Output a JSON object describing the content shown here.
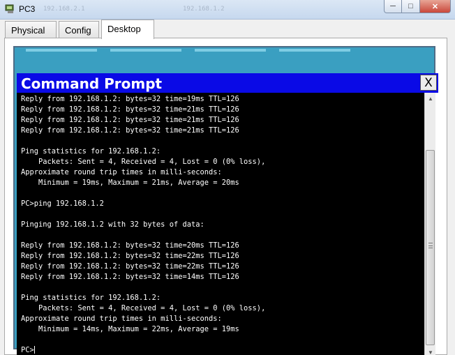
{
  "window": {
    "title": "PC3",
    "ghost_texts": [
      "192.168.2.1",
      "192.168.1.2"
    ],
    "icons": {
      "app": "pc-icon",
      "minimize": "minimize-icon",
      "maximize": "maximize-icon",
      "close": "close-icon"
    },
    "minimize_glyph": "─",
    "maximize_glyph": "□",
    "close_glyph": "✕"
  },
  "tabs": [
    {
      "label": "Physical",
      "active": false
    },
    {
      "label": "Config",
      "active": false
    },
    {
      "label": "Desktop",
      "active": true
    }
  ],
  "command_prompt": {
    "title": "Command Prompt",
    "close_label": "X",
    "lines": [
      "Reply from 192.168.1.2: bytes=32 time=19ms TTL=126",
      "Reply from 192.168.1.2: bytes=32 time=21ms TTL=126",
      "Reply from 192.168.1.2: bytes=32 time=21ms TTL=126",
      "Reply from 192.168.1.2: bytes=32 time=21ms TTL=126",
      "",
      "Ping statistics for 192.168.1.2:",
      "    Packets: Sent = 4, Received = 4, Lost = 0 (0% loss),",
      "Approximate round trip times in milli-seconds:",
      "    Minimum = 19ms, Maximum = 21ms, Average = 20ms",
      "",
      "PC>ping 192.168.1.2",
      "",
      "Pinging 192.168.1.2 with 32 bytes of data:",
      "",
      "Reply from 192.168.1.2: bytes=32 time=20ms TTL=126",
      "Reply from 192.168.1.2: bytes=32 time=22ms TTL=126",
      "Reply from 192.168.1.2: bytes=32 time=22ms TTL=126",
      "Reply from 192.168.1.2: bytes=32 time=14ms TTL=126",
      "",
      "Ping statistics for 192.168.1.2:",
      "    Packets: Sent = 4, Received = 4, Lost = 0 (0% loss),",
      "Approximate round trip times in milli-seconds:",
      "    Minimum = 14ms, Maximum = 22ms, Average = 19ms",
      ""
    ],
    "prompt": "PC>"
  },
  "scrollbar": {
    "up_glyph": "▲",
    "down_glyph": "▼"
  },
  "colors": {
    "cmd_title_bg": "#0a0ae6",
    "console_bg": "#000000",
    "console_fg": "#ffffff",
    "desktop_bg": "#3a9fc1"
  }
}
